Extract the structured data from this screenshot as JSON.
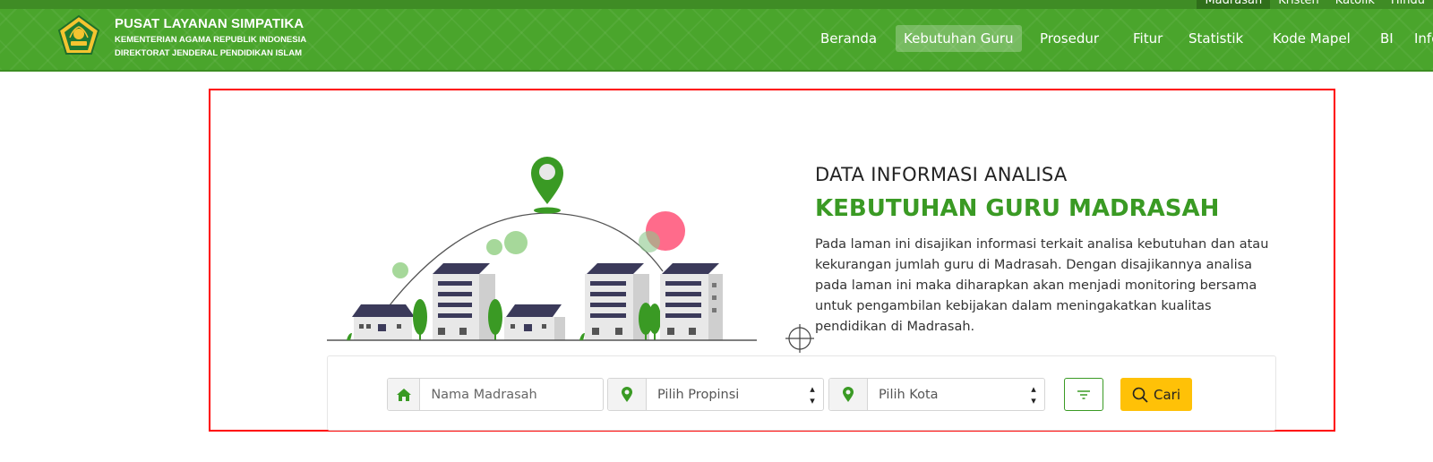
{
  "top_tabs": [
    "Madrasah",
    "Kristen",
    "Katolik",
    "Hindu"
  ],
  "brand": {
    "title": "PUSAT LAYANAN SIMPATIKA",
    "line1": "KEMENTERIAN AGAMA REPUBLIK INDONESIA",
    "line2": "DIREKTORAT JENDERAL PENDIDIKAN ISLAM"
  },
  "nav": {
    "items": [
      "Beranda",
      "Kebutuhan Guru",
      "Prosedur",
      "Fitur",
      "Statistik",
      "Kode Mapel",
      "BI",
      "Info"
    ],
    "active": "Kebutuhan Guru"
  },
  "hero": {
    "pretitle": "DATA INFORMASI ANALISA",
    "title": "KEBUTUHAN GURU MADRASAH",
    "description": "Pada laman ini disajikan informasi terkait analisa kebutuhan dan atau kekurangan jumlah guru di Madrasah. Dengan disajikannya analisa pada laman ini maka diharapkan akan menjadi monitoring bersama untuk pengambilan kebijakan dalam meningakatkan kualitas pendidikan di Madrasah."
  },
  "search": {
    "madrasah_placeholder": "Nama Madrasah",
    "province_select": "Pilih Propinsi",
    "city_select": "Pilih Kota",
    "search_button": "Cari"
  },
  "colors": {
    "brand_green": "#4aa52c",
    "title_green": "#3a9a24",
    "button_yellow": "#ffc107",
    "highlight_red": "#ff0000"
  },
  "icons": {
    "madrasah_field": "home-icon",
    "province_field": "map-pin-icon",
    "city_field": "map-pin-icon",
    "filter": "filter-icon",
    "search": "search-icon"
  }
}
